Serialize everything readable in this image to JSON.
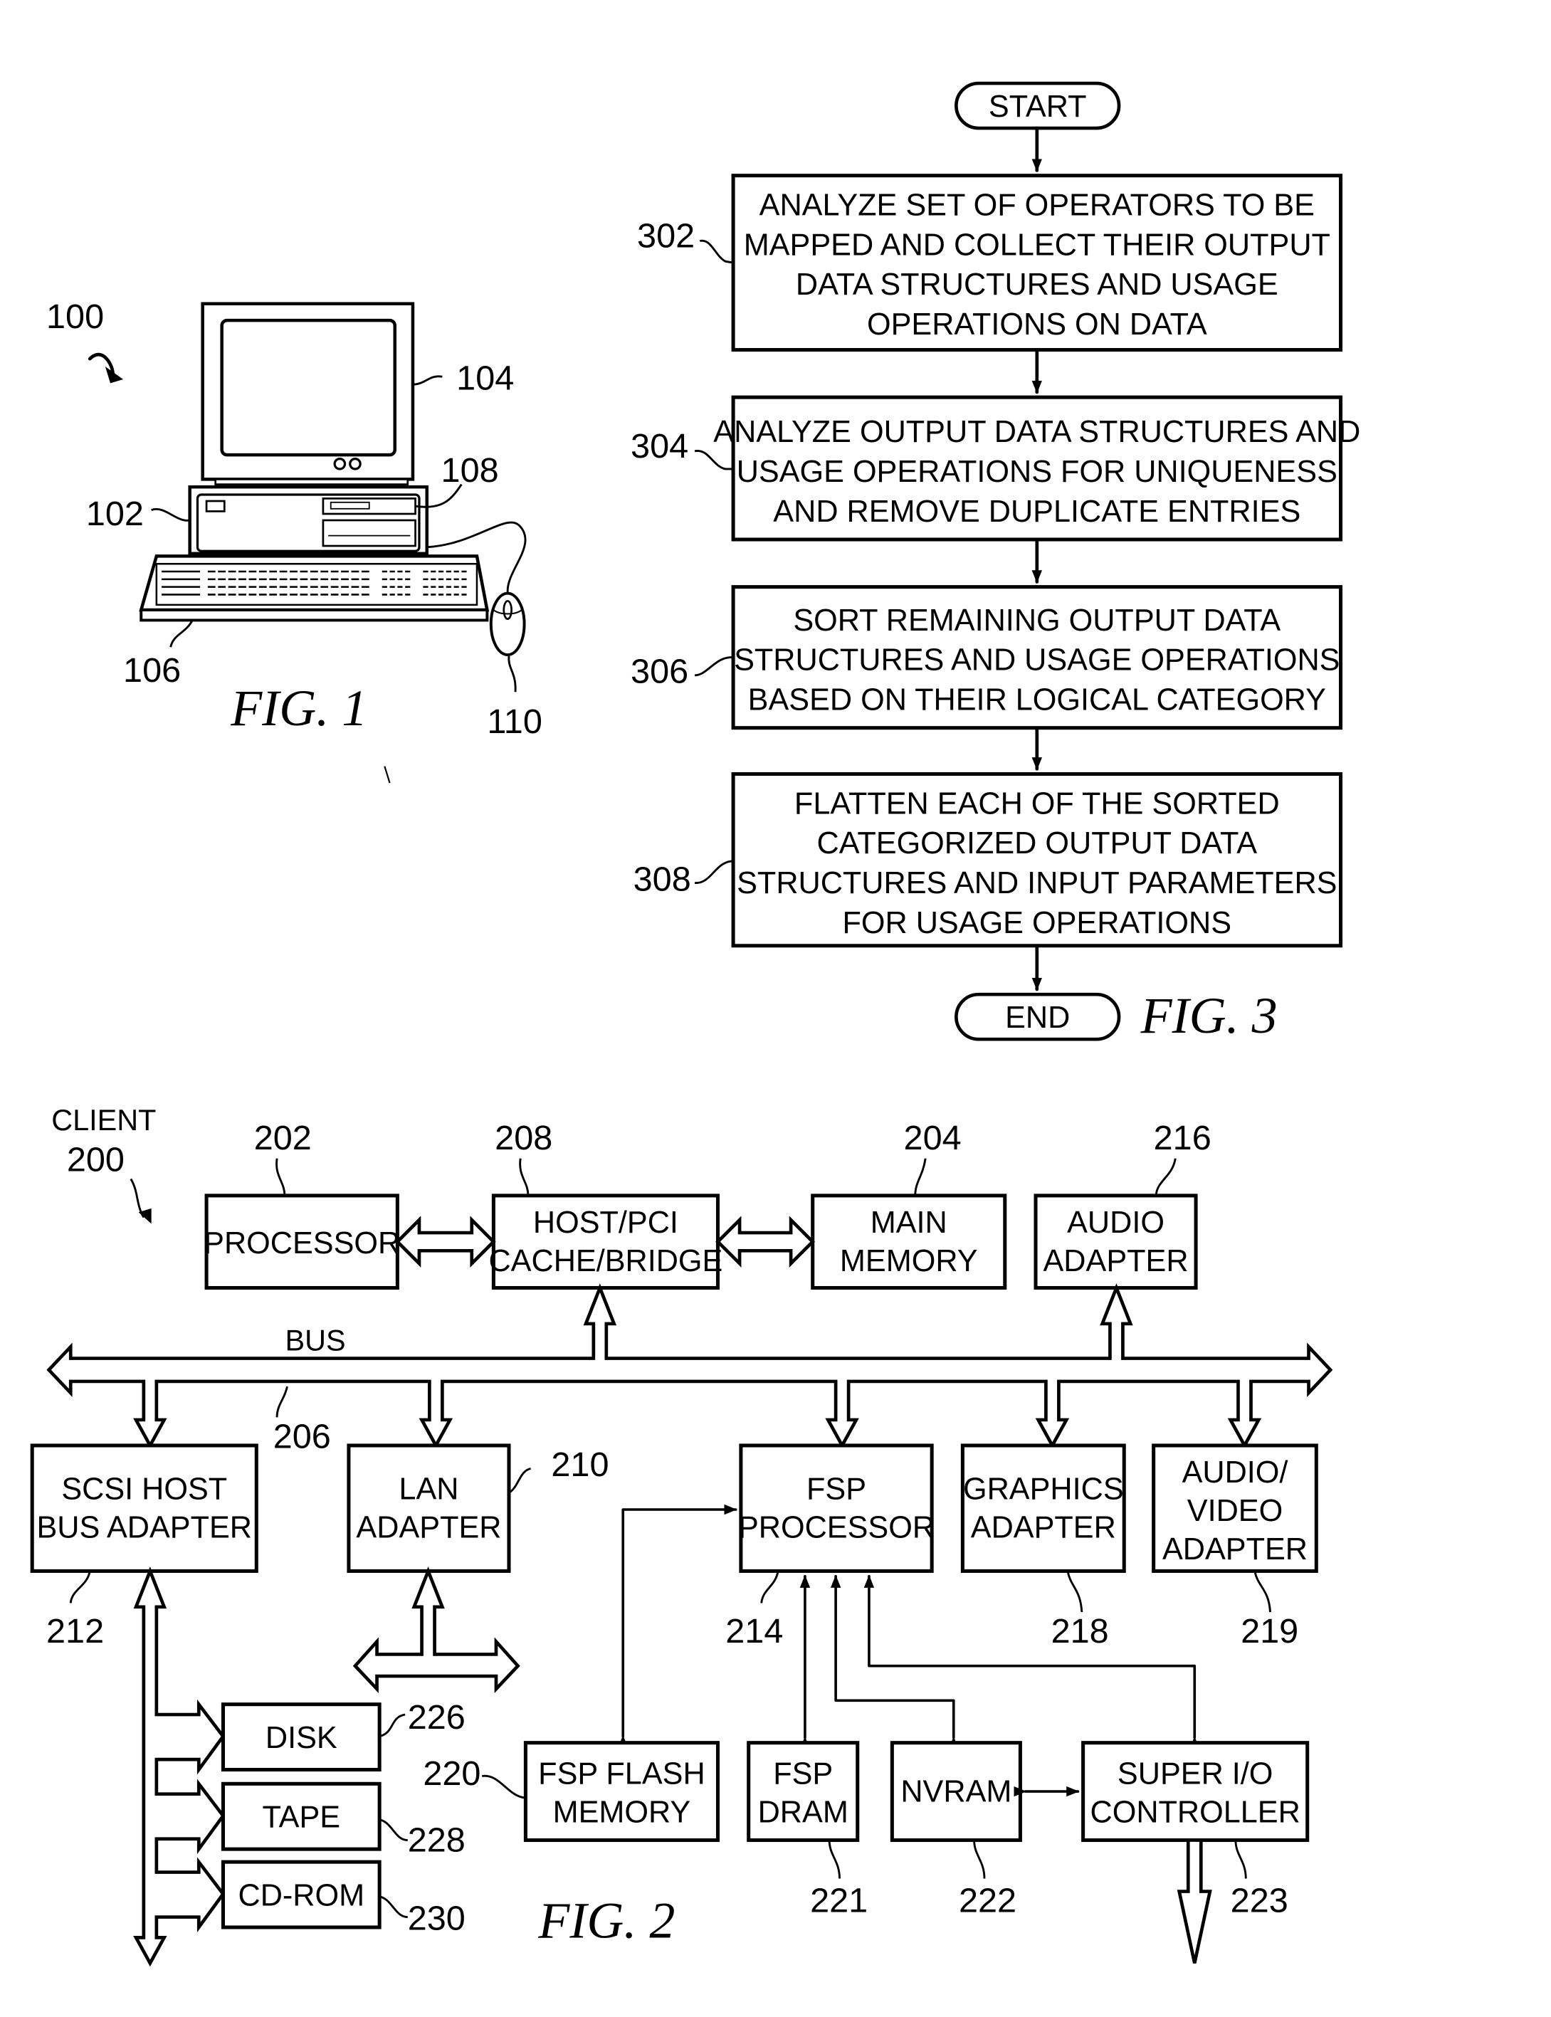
{
  "fig1": {
    "caption": "FIG. 1",
    "refs": {
      "system": "100",
      "cpu_unit": "102",
      "monitor": "104",
      "keyboard": "106",
      "storage_drive": "108",
      "mouse": "110"
    }
  },
  "fig3": {
    "caption": "FIG. 3",
    "start_label": "START",
    "end_label": "END",
    "steps": [
      {
        "ref": "302",
        "lines": [
          "ANALYZE SET OF OPERATORS TO BE",
          "MAPPED AND COLLECT THEIR OUTPUT",
          "DATA STRUCTURES AND USAGE",
          "OPERATIONS ON DATA"
        ]
      },
      {
        "ref": "304",
        "lines": [
          "ANALYZE OUTPUT DATA STRUCTURES AND",
          "USAGE OPERATIONS FOR UNIQUENESS",
          "AND REMOVE DUPLICATE ENTRIES"
        ]
      },
      {
        "ref": "306",
        "lines": [
          "SORT REMAINING OUTPUT DATA",
          "STRUCTURES AND USAGE OPERATIONS",
          "BASED ON THEIR LOGICAL CATEGORY"
        ]
      },
      {
        "ref": "308",
        "lines": [
          "FLATTEN EACH OF THE SORTED",
          "CATEGORIZED OUTPUT DATA",
          "STRUCTURES AND INPUT PARAMETERS",
          "FOR USAGE OPERATIONS"
        ]
      }
    ]
  },
  "fig2": {
    "caption": "FIG. 2",
    "client_label": "CLIENT",
    "client_ref": "200",
    "bus_label": "BUS",
    "bus_ref": "206",
    "blocks": {
      "processor": {
        "ref": "202",
        "lines": [
          "PROCESSOR"
        ]
      },
      "host_pci": {
        "ref": "208",
        "lines": [
          "HOST/PCI",
          "CACHE/BRIDGE"
        ]
      },
      "main_memory": {
        "ref": "204",
        "lines": [
          "MAIN",
          "MEMORY"
        ]
      },
      "audio_adapter": {
        "ref": "216",
        "lines": [
          "AUDIO",
          "ADAPTER"
        ]
      },
      "scsi": {
        "ref": "212",
        "lines": [
          "SCSI HOST",
          "BUS ADAPTER"
        ]
      },
      "lan": {
        "ref": "210",
        "lines": [
          "LAN",
          "ADAPTER"
        ]
      },
      "fsp_processor": {
        "ref": "214",
        "lines": [
          "FSP",
          "PROCESSOR"
        ]
      },
      "graphics": {
        "ref": "218",
        "lines": [
          "GRAPHICS",
          "ADAPTER"
        ]
      },
      "av_adapter": {
        "ref": "219",
        "lines": [
          "AUDIO/",
          "VIDEO",
          "ADAPTER"
        ]
      },
      "fsp_flash": {
        "ref": "220",
        "lines": [
          "FSP FLASH",
          "MEMORY"
        ]
      },
      "fsp_dram": {
        "ref": "221",
        "lines": [
          "FSP",
          "DRAM"
        ]
      },
      "nvram": {
        "ref": "222",
        "lines": [
          "NVRAM"
        ]
      },
      "super_io": {
        "ref": "223",
        "lines": [
          "SUPER I/O",
          "CONTROLLER"
        ]
      },
      "disk": {
        "ref": "226",
        "lines": [
          "DISK"
        ]
      },
      "tape": {
        "ref": "228",
        "lines": [
          "TAPE"
        ]
      },
      "cdrom": {
        "ref": "230",
        "lines": [
          "CD-ROM"
        ]
      }
    }
  }
}
